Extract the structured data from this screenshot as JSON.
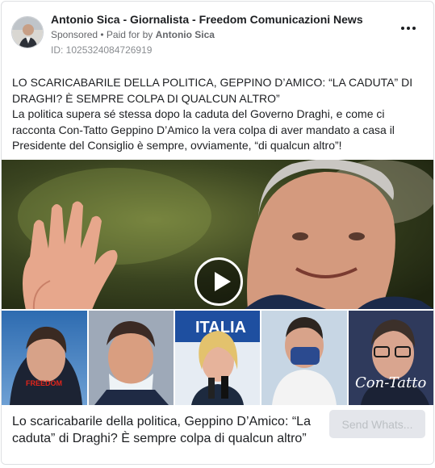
{
  "post": {
    "page_name": "Antonio Sica - Giornalista - Freedom Comunicazioni News",
    "sponsored": "Sponsored",
    "paid_for_prefix": " • Paid for by ",
    "paid_for_by": "Antonio Sica",
    "ad_id": "ID: 1025324084726919",
    "more_icon": "more-horizontal-icon",
    "headline_1": "LO SCARICABARILE DELLA POLITICA, GEPPINO D’AMICO: “LA CADUTA” DI",
    "headline_2": "DRAGHI? È SEMPRE COLPA DI QUALCUN ALTRO”",
    "body_1": "La politica supera sé stessa dopo la caduta del Governo Draghi, e come ci",
    "body_2": "racconta Con-Tatto Geppino D’Amico la vera colpa di aver mandato a casa il",
    "body_3": "Presidente del Consiglio è sempre, ovviamente, “di qualcun altro”!"
  },
  "media": {
    "banner_text": "FRATELLI D'ITALIA",
    "watermark_left": "FREEDOM",
    "watermark_right": "Con-Tatto",
    "play_icon": "play-icon"
  },
  "footer": {
    "link_title": "Lo scaricabarile della politica, Geppino D’Amico: “La caduta” di Draghi? È sempre colpa di qualcun altro”",
    "cta_label": "Send Whats..."
  },
  "colors": {
    "text": "#1c1e21",
    "muted": "#65676b",
    "cta_bg": "#e4e6eb",
    "cta_text": "#bcc0c4"
  }
}
